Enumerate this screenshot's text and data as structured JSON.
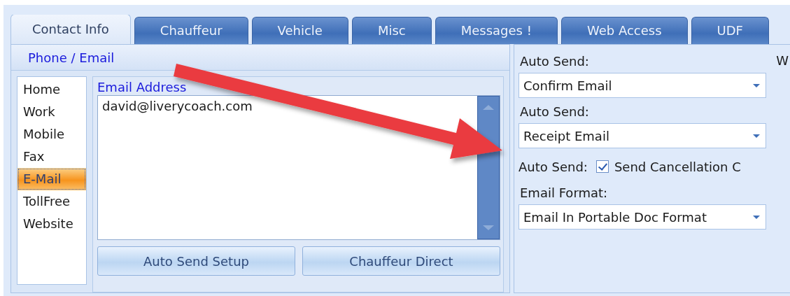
{
  "tabs": [
    {
      "label": "Contact Info",
      "selected": true
    },
    {
      "label": "Chauffeur",
      "selected": false
    },
    {
      "label": "Vehicle",
      "selected": false
    },
    {
      "label": "Misc",
      "selected": false
    },
    {
      "label": "Messages !",
      "selected": false
    },
    {
      "label": "Web Access",
      "selected": false
    },
    {
      "label": "UDF",
      "selected": false
    }
  ],
  "contact_panel": {
    "title": "Phone / Email",
    "types": [
      {
        "label": "Home",
        "selected": false
      },
      {
        "label": "Work",
        "selected": false
      },
      {
        "label": "Mobile",
        "selected": false
      },
      {
        "label": "Fax",
        "selected": false
      },
      {
        "label": "E-Mail",
        "selected": true
      },
      {
        "label": "TollFree",
        "selected": false
      },
      {
        "label": "Website",
        "selected": false
      }
    ],
    "field_label": "Email Address",
    "value": "david@liverycoach.com",
    "buttons": [
      "Auto Send Setup",
      "Chauffeur Direct"
    ]
  },
  "auto_send_panel": {
    "corner_label": "W",
    "rows": [
      {
        "kind": "dropdown",
        "label": "Auto Send:",
        "value": "Confirm Email"
      },
      {
        "kind": "dropdown",
        "label": "Auto Send:",
        "value": "Receipt Email"
      },
      {
        "kind": "checkbox",
        "label": "Auto Send:",
        "text": "Send Cancellation C",
        "checked": true
      },
      {
        "kind": "dropdown",
        "label": "Email Format:",
        "value": "Email In Portable Doc Format"
      }
    ]
  }
}
